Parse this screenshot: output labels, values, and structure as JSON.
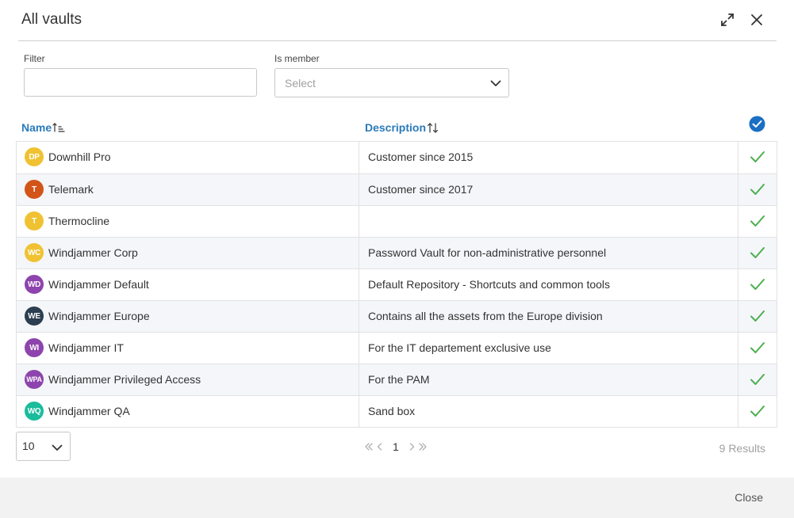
{
  "dialog": {
    "title": "All vaults"
  },
  "filters": {
    "filter_label": "Filter",
    "filter_value": "",
    "member_label": "Is member",
    "member_placeholder": "Select"
  },
  "table": {
    "columns": {
      "name": "Name",
      "description": "Description"
    },
    "rows": [
      {
        "initials": "DP",
        "avatar_color": "#f0c232",
        "name": "Downhill Pro",
        "description": "Customer since 2015"
      },
      {
        "initials": "T",
        "avatar_color": "#d35418",
        "name": "Telemark",
        "description": "Customer since 2017"
      },
      {
        "initials": "T",
        "avatar_color": "#f0c232",
        "name": "Thermocline",
        "description": ""
      },
      {
        "initials": "WC",
        "avatar_color": "#f0c232",
        "name": "Windjammer Corp",
        "description": "Password Vault for non-administrative personnel"
      },
      {
        "initials": "WD",
        "avatar_color": "#8e44ad",
        "name": "Windjammer Default",
        "description": "Default Repository - Shortcuts and common tools"
      },
      {
        "initials": "WE",
        "avatar_color": "#2c3e50",
        "name": "Windjammer Europe",
        "description": "Contains all the assets from the Europe division"
      },
      {
        "initials": "WI",
        "avatar_color": "#8e44ad",
        "name": "Windjammer IT",
        "description": "For the IT departement exclusive use"
      },
      {
        "initials": "WPA",
        "avatar_color": "#8e44ad",
        "name": "Windjammer Privileged Access",
        "description": "For the PAM"
      },
      {
        "initials": "WQ",
        "avatar_color": "#1abc9c",
        "name": "Windjammer QA",
        "description": "Sand box"
      }
    ]
  },
  "pagination": {
    "page_size": "10",
    "current_page": "1",
    "results": "9 Results"
  },
  "footer": {
    "close_label": "Close"
  },
  "colors": {
    "accent": "#2a7ab9",
    "check": "#4caf50",
    "header_check": "#1a6fc4"
  }
}
